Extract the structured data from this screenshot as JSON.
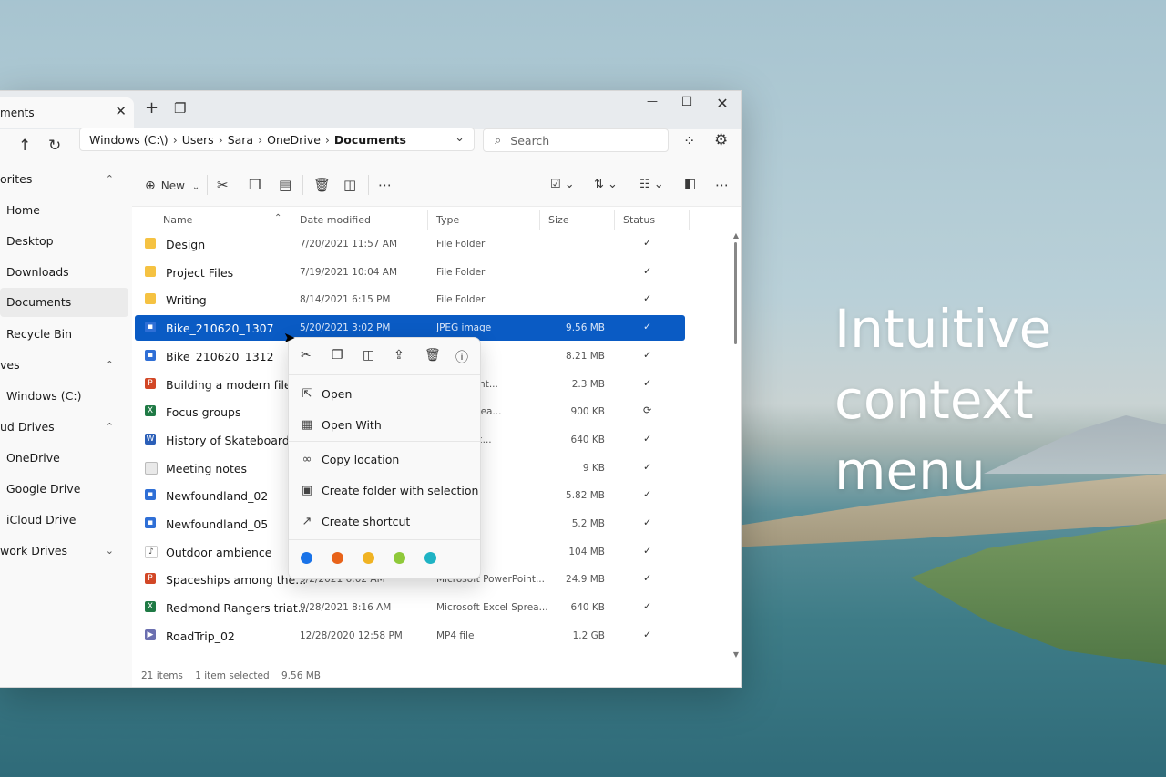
{
  "headline": [
    "Intuitive",
    "context",
    "menu"
  ],
  "tab": {
    "label": "ments",
    "close": "✕"
  },
  "titlebar": {
    "new_tab": "+",
    "tab_overview": "❐",
    "minimize": "—",
    "maximize": "☐",
    "close": "✕"
  },
  "nav": {
    "back": "↑",
    "refresh": "↻",
    "more": "⋯"
  },
  "address": {
    "crumbs": [
      "Windows (C:\\)",
      "Users",
      "Sara",
      "OneDrive",
      "Documents"
    ],
    "separator": "›",
    "chevron": "⌄"
  },
  "search": {
    "placeholder": "Search",
    "icon": "⌕"
  },
  "sidebar": {
    "items": [
      {
        "label": "orites",
        "chevron": "⌃"
      },
      {
        "label": "Home"
      },
      {
        "label": "Desktop"
      },
      {
        "label": "Downloads"
      },
      {
        "label": "Documents",
        "selected": true
      },
      {
        "label": "Recycle Bin"
      },
      {
        "label": "ves",
        "chevron": "⌃"
      },
      {
        "label": "Windows (C:)"
      },
      {
        "label": "ud Drives",
        "chevron": "⌃"
      },
      {
        "label": "OneDrive"
      },
      {
        "label": "Google Drive"
      },
      {
        "label": "iCloud Drive"
      },
      {
        "label": "work Drives",
        "chevron": "⌄"
      }
    ]
  },
  "cmdbar": {
    "new_label": "New",
    "more": "⋯"
  },
  "columns": {
    "name": "Name",
    "date": "Date modified",
    "type": "Type",
    "size": "Size",
    "status": "Status"
  },
  "files": [
    {
      "name": "Design",
      "date": "7/20/2021  11:57 AM",
      "type": "File Folder",
      "size": "",
      "status": "✓",
      "kind": "folder"
    },
    {
      "name": "Project Files",
      "date": "7/19/2021  10:04 AM",
      "type": "File Folder",
      "size": "",
      "status": "✓",
      "kind": "folder"
    },
    {
      "name": "Writing",
      "date": "8/14/2021  6:15 PM",
      "type": "File Folder",
      "size": "",
      "status": "✓",
      "kind": "folder"
    },
    {
      "name": "Bike_210620_1307",
      "date": "5/20/2021  3:02 PM",
      "type": "JPEG image",
      "size": "9.56 MB",
      "status": "✓",
      "kind": "image",
      "selected": true
    },
    {
      "name": "Bike_210620_1312",
      "date": "",
      "type": "e",
      "size": "8.21 MB",
      "status": "✓",
      "kind": "image"
    },
    {
      "name": "Building a modern file...",
      "date": "",
      "type": "PowerPoint...",
      "size": "2.3 MB",
      "status": "✓",
      "kind": "ppt"
    },
    {
      "name": "Focus groups",
      "date": "",
      "type": "Excel Sprea...",
      "size": "900 KB",
      "status": "⟳",
      "kind": "xls"
    },
    {
      "name": "History of Skateboards",
      "date": "",
      "type": "Word Doc...",
      "size": "640 KB",
      "status": "✓",
      "kind": "doc"
    },
    {
      "name": "Meeting notes",
      "date": "",
      "type": "ment",
      "size": "9 KB",
      "status": "✓",
      "kind": "txt"
    },
    {
      "name": "Newfoundland_02",
      "date": "",
      "type": "e",
      "size": "5.82 MB",
      "status": "✓",
      "kind": "image"
    },
    {
      "name": "Newfoundland_05",
      "date": "",
      "type": "e",
      "size": "5.2 MB",
      "status": "✓",
      "kind": "image"
    },
    {
      "name": "Outdoor ambience",
      "date": "",
      "type": "",
      "size": "104 MB",
      "status": "✓",
      "kind": "audio"
    },
    {
      "name": "Spaceships among the...",
      "date": "9/2/2021  6:02 AM",
      "type": "Microsoft PowerPoint...",
      "size": "24.9 MB",
      "status": "✓",
      "kind": "ppt"
    },
    {
      "name": "Redmond Rangers triat...",
      "date": "9/28/2021  8:16 AM",
      "type": "Microsoft Excel Sprea...",
      "size": "640 KB",
      "status": "✓",
      "kind": "xls"
    },
    {
      "name": "RoadTrip_02",
      "date": "12/28/2020  12:58 PM",
      "type": "MP4 file",
      "size": "1.2 GB",
      "status": "✓",
      "kind": "video"
    }
  ],
  "statusbar": {
    "count": "21 items",
    "selected": "1 item selected",
    "size": "9.56 MB"
  },
  "context_menu": {
    "items": [
      {
        "label": "Open",
        "icon": "⇱"
      },
      {
        "label": "Open With",
        "icon": "▦"
      },
      {
        "label": "Copy location",
        "icon": "∞"
      },
      {
        "label": "Create folder with selection",
        "icon": "▣"
      },
      {
        "label": "Create shortcut",
        "icon": "↗"
      }
    ],
    "tag_colors": [
      "#1a73e8",
      "#e8631a",
      "#f0b323",
      "#8fc93a",
      "#1fb3c4"
    ]
  },
  "colors": {
    "accent": "#0a5bc4"
  }
}
